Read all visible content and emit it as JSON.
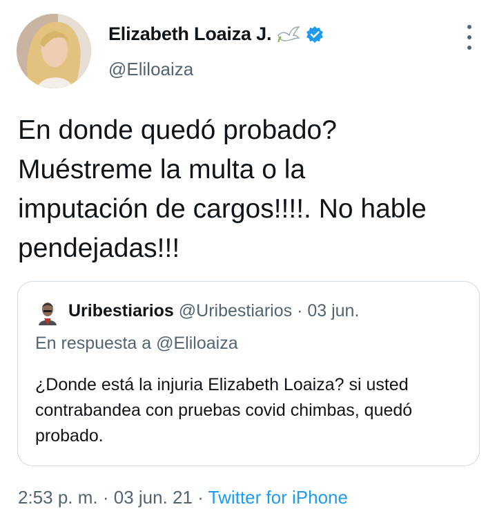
{
  "tweet": {
    "author": {
      "display_name": "Elizabeth Loaiza J.",
      "handle": "@Eliloaiza",
      "name_emoji": "dove-emoji",
      "verified_icon": "verified-badge-icon"
    },
    "text": "En donde quedó probado?\nMuéstreme la multa o la\nimputación de cargos!!!!. No hable\npendejadas!!!",
    "quoted": {
      "display_name": "Uribestiarios",
      "handle": "@Uribestiarios",
      "separator": "·",
      "date": "03 jun.",
      "reply_context": "En respuesta a @Eliloaiza",
      "text": "¿Donde está la injuria Elizabeth Loaiza? si usted contrabandea con pruebas covid chimbas, quedó probado."
    },
    "footer": {
      "time": "2:53 p. m.",
      "separator": "·",
      "date": "03 jun. 21",
      "source": "Twitter for iPhone"
    }
  },
  "colors": {
    "text": "#0f1419",
    "secondary": "#536471",
    "link": "#1d9bf0",
    "verified": "#1d9bf0",
    "border": "#cfd9de"
  }
}
